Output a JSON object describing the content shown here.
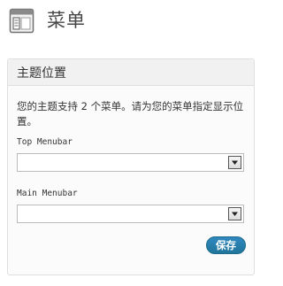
{
  "page": {
    "title": "菜单",
    "icon": "menus-icon"
  },
  "theme_locations": {
    "title": "主题位置",
    "description": "您的主题支持 2 个菜单。请为您的菜单指定显示位置。",
    "fields": [
      {
        "label": "Top Menubar",
        "value": ""
      },
      {
        "label": "Main Menubar",
        "value": ""
      }
    ],
    "save_label": "保存"
  },
  "colors": {
    "button": "#21759b",
    "box_border": "#dfdfdf",
    "box_header": "#f1f1f1"
  }
}
